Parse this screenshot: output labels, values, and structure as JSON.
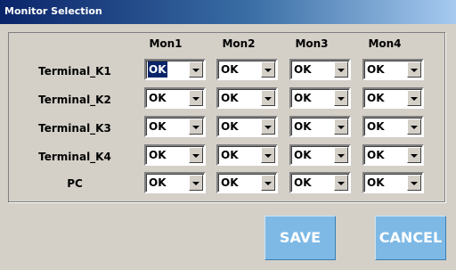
{
  "window": {
    "title": "Monitor Selection"
  },
  "columns": [
    "Mon1",
    "Mon2",
    "Mon3",
    "Mon4"
  ],
  "rows": [
    {
      "label": "Terminal_K1",
      "values": [
        "OK",
        "OK",
        "OK",
        "OK"
      ]
    },
    {
      "label": "Terminal_K2",
      "values": [
        "OK",
        "OK",
        "OK",
        "OK"
      ]
    },
    {
      "label": "Terminal_K3",
      "values": [
        "OK",
        "OK",
        "OK",
        "OK"
      ]
    },
    {
      "label": "Terminal_K4",
      "values": [
        "OK",
        "OK",
        "OK",
        "OK"
      ]
    },
    {
      "label": "PC",
      "values": [
        "OK",
        "OK",
        "OK",
        "OK"
      ]
    }
  ],
  "icons": {
    "dropdown": "chevron-down-icon"
  },
  "buttons": {
    "save_label": "SAVE",
    "cancel_label": "CANCEL"
  },
  "colors": {
    "title_bar": "#0a246a",
    "button_face": "#7eb9e6",
    "selection": "#0a246a"
  }
}
